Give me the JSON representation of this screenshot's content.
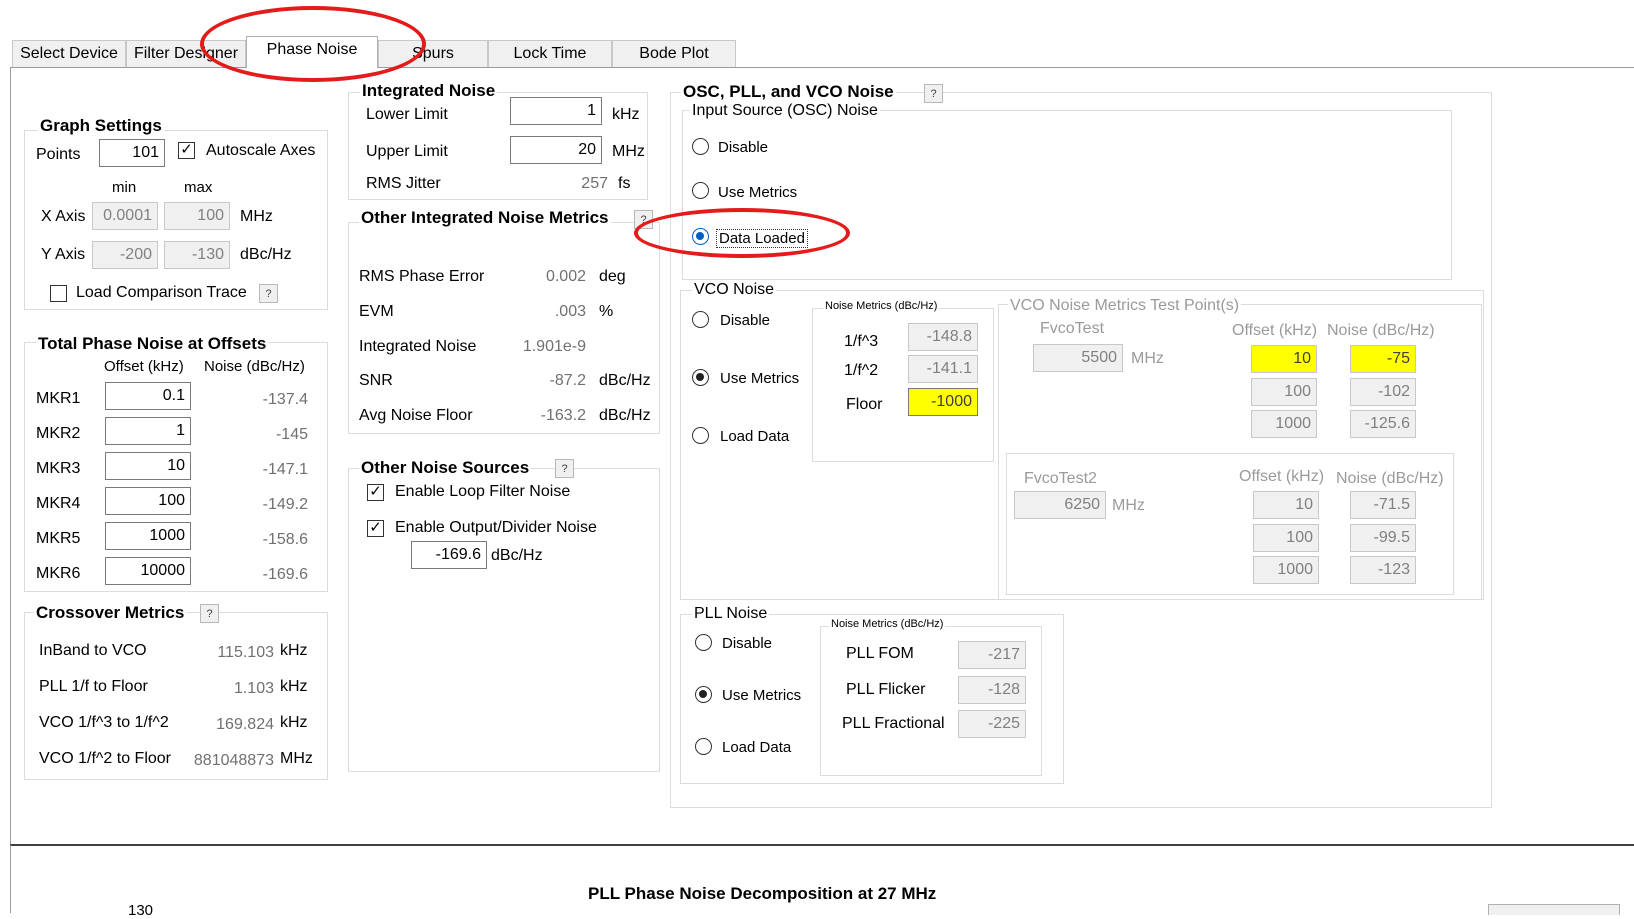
{
  "tabs": [
    "Select Device",
    "Filter Designer",
    "Phase Noise",
    "Spurs",
    "Lock Time",
    "Bode Plot"
  ],
  "graph_settings": {
    "title": "Graph Settings",
    "points_label": "Points",
    "points_value": "101",
    "autoscale_label": "Autoscale Axes",
    "autoscale_checked": true,
    "min_label": "min",
    "max_label": "max",
    "x_axis_label": "X Axis",
    "x_min": "0.0001",
    "x_max": "100",
    "x_unit": "MHz",
    "y_axis_label": "Y Axis",
    "y_min": "-200",
    "y_max": "-130",
    "y_unit": "dBc/Hz",
    "load_comparison_label": "Load Comparison Trace",
    "help": "?"
  },
  "total_phase_noise": {
    "title": "Total Phase Noise at Offsets",
    "col_offset": "Offset (kHz)",
    "col_noise": "Noise (dBc/Hz)",
    "rows": [
      {
        "label": "MKR1",
        "offset": "0.1",
        "noise": "-137.4"
      },
      {
        "label": "MKR2",
        "offset": "1",
        "noise": "-145"
      },
      {
        "label": "MKR3",
        "offset": "10",
        "noise": "-147.1"
      },
      {
        "label": "MKR4",
        "offset": "100",
        "noise": "-149.2"
      },
      {
        "label": "MKR5",
        "offset": "1000",
        "noise": "-158.6"
      },
      {
        "label": "MKR6",
        "offset": "10000",
        "noise": "-169.6"
      }
    ]
  },
  "crossover": {
    "title": "Crossover Metrics",
    "help": "?",
    "rows": [
      {
        "label": "InBand to VCO",
        "value": "115.103",
        "unit": "kHz"
      },
      {
        "label": "PLL 1/f to Floor",
        "value": "1.103",
        "unit": "kHz"
      },
      {
        "label": "VCO 1/f^3 to 1/f^2",
        "value": "169.824",
        "unit": "kHz"
      },
      {
        "label": "VCO 1/f^2 to Floor",
        "value": "881048873",
        "unit": "MHz"
      }
    ]
  },
  "integrated_noise": {
    "title": "Integrated Noise",
    "lower_label": "Lower Limit",
    "lower_value": "1",
    "lower_unit": "kHz",
    "upper_label": "Upper Limit",
    "upper_value": "20",
    "upper_unit": "MHz",
    "jitter_label": "RMS Jitter",
    "jitter_value": "257",
    "jitter_unit": "fs"
  },
  "other_metrics": {
    "title": "Other Integrated Noise Metrics",
    "help": "?",
    "rows": [
      {
        "label": "RMS Phase Error",
        "value": "0.002",
        "unit": "deg"
      },
      {
        "label": "EVM",
        "value": ".003",
        "unit": "%"
      },
      {
        "label": "Integrated Noise",
        "value": "1.901e-9",
        "unit": ""
      },
      {
        "label": "SNR",
        "value": "-87.2",
        "unit": "dBc/Hz"
      },
      {
        "label": "Avg Noise Floor",
        "value": "-163.2",
        "unit": "dBc/Hz"
      }
    ]
  },
  "other_sources": {
    "title": "Other Noise Sources",
    "help": "?",
    "loop_filter_label": "Enable Loop Filter Noise",
    "loop_filter_checked": true,
    "output_divider_label": "Enable Output/Divider Noise",
    "output_divider_checked": true,
    "output_value": "-169.6",
    "output_unit": "dBc/Hz"
  },
  "osc_pll_vco": {
    "title": "OSC, PLL, and VCO Noise",
    "help": "?",
    "input_source": {
      "title": "Input Source (OSC) Noise",
      "options": [
        "Disable",
        "Use Metrics",
        "Data Loaded"
      ],
      "selected": 2
    },
    "vco": {
      "title": "VCO Noise",
      "options": [
        "Disable",
        "Use Metrics",
        "Load Data"
      ],
      "selected": 1,
      "metrics_title": "Noise Metrics (dBc/Hz)",
      "f3_label": "1/f^3",
      "f3_value": "-148.8",
      "f2_label": "1/f^2",
      "f2_value": "-141.1",
      "floor_label": "Floor",
      "floor_value": "-1000",
      "test_title": "VCO Noise Metrics Test Point(s)",
      "test1": {
        "label": "FvcoTest",
        "value": "5500",
        "unit": "MHz",
        "col_offset": "Offset (kHz)",
        "col_noise": "Noise (dBc/Hz)",
        "rows": [
          {
            "offset": "10",
            "noise": "-75"
          },
          {
            "offset": "100",
            "noise": "-102"
          },
          {
            "offset": "1000",
            "noise": "-125.6"
          }
        ]
      },
      "test2": {
        "label": "FvcoTest2",
        "value": "6250",
        "unit": "MHz",
        "col_offset": "Offset (kHz)",
        "col_noise": "Noise (dBc/Hz)",
        "rows": [
          {
            "offset": "10",
            "noise": "-71.5"
          },
          {
            "offset": "100",
            "noise": "-99.5"
          },
          {
            "offset": "1000",
            "noise": "-123"
          }
        ]
      }
    },
    "pll": {
      "title": "PLL Noise",
      "options": [
        "Disable",
        "Use Metrics",
        "Load Data"
      ],
      "selected": 1,
      "metrics_title": "Noise Metrics (dBc/Hz)",
      "fom_label": "PLL FOM",
      "fom_value": "-217",
      "flicker_label": "PLL Flicker",
      "flicker_value": "-128",
      "fractional_label": "PLL Fractional",
      "fractional_value": "-225"
    }
  },
  "bottom_chart": {
    "title": "PLL Phase Noise Decomposition at 27 MHz",
    "y_tick_partial": "130"
  },
  "colors": {
    "annotation_red": "#e31b1b",
    "highlight_yellow": "#ffff00",
    "radio_blue": "#0060c0"
  }
}
